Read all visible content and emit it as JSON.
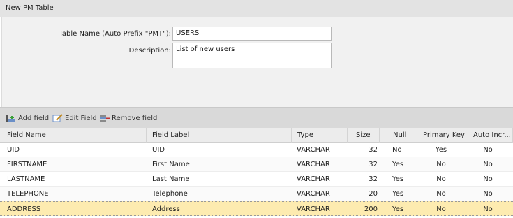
{
  "window": {
    "title": "New PM Table"
  },
  "form": {
    "table_name_label": "Table Name (Auto Prefix \"PMT\"):",
    "table_name_value": "USERS",
    "description_label": "Description:",
    "description_value": "List of new users"
  },
  "toolbar": {
    "add_field": "Add field",
    "edit_field": "Edit Field",
    "remove_field": "Remove field"
  },
  "grid": {
    "columns": [
      "Field Name",
      "Field Label",
      "Type",
      "Size",
      "Null",
      "Primary Key",
      "Auto Incr..."
    ],
    "rows": [
      {
        "name": "UID",
        "label": "UID",
        "type": "VARCHAR",
        "size": "32",
        "null": "No",
        "pk": "Yes",
        "auto": "No"
      },
      {
        "name": "FIRSTNAME",
        "label": "First Name",
        "type": "VARCHAR",
        "size": "32",
        "null": "Yes",
        "pk": "No",
        "auto": "No"
      },
      {
        "name": "LASTNAME",
        "label": "Last Name",
        "type": "VARCHAR",
        "size": "32",
        "null": "Yes",
        "pk": "No",
        "auto": "No"
      },
      {
        "name": "TELEPHONE",
        "label": "Telephone",
        "type": "VARCHAR",
        "size": "20",
        "null": "Yes",
        "pk": "No",
        "auto": "No"
      },
      {
        "name": "ADDRESS",
        "label": "Address",
        "type": "VARCHAR",
        "size": "200",
        "null": "Yes",
        "pk": "No",
        "auto": "No"
      }
    ]
  },
  "colors": {
    "selected_row": "#fdebb0",
    "toolbar_bg": "#d9d9d9",
    "form_bg": "#f1f1f1"
  }
}
